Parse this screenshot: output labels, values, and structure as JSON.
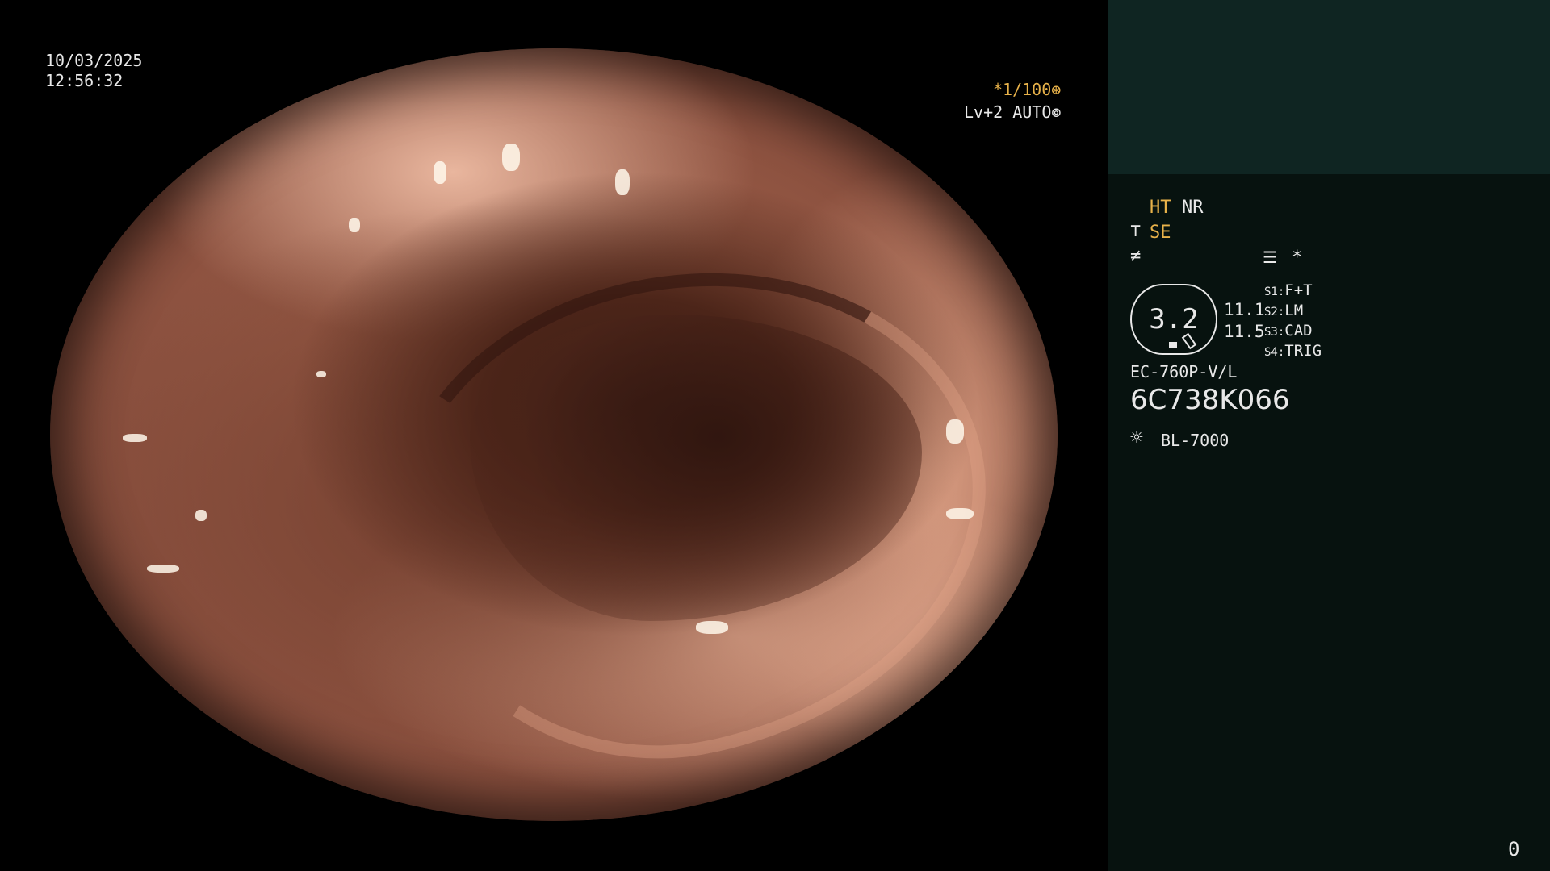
{
  "overlay": {
    "date": "10/03/2025",
    "time": "12:56:32",
    "shutter": "*1/100",
    "shutter_icon": "aperture-icon",
    "level": "Lv+2 AUTO",
    "level_icon": "iris-icon"
  },
  "panel": {
    "ht": "HT",
    "nr": "NR",
    "se": "SE",
    "se_icon": "structure-enhance-icon",
    "flat_icon": "color-mode-icon",
    "menu_icon": "memo-icon",
    "star": "*",
    "zoom_badge": "3.2",
    "value1": "11.1",
    "value2": "11.5",
    "switches": [
      {
        "label": "S1:",
        "value": "F+T"
      },
      {
        "label": "S2:",
        "value": "LM"
      },
      {
        "label": "S3:",
        "value": "CAD"
      },
      {
        "label": "S4:",
        "value": "TRIG"
      }
    ],
    "scope_model": "EC-760P-V/L",
    "scope_serial": "6C738K066",
    "light_source": "BL-7000",
    "light_icon": "sun-icon",
    "corner_counter": "0"
  },
  "colors": {
    "accent": "#e8b24a",
    "panel_bg": "#07120f",
    "panel_top_bg": "#0f2522",
    "text": "#e8e8e8"
  }
}
